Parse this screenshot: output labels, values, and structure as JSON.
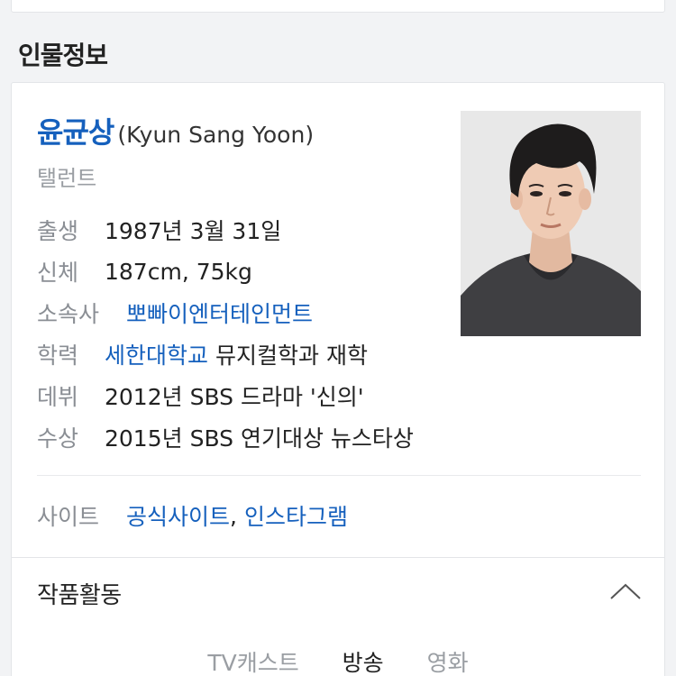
{
  "section": {
    "title": "인물정보"
  },
  "profile": {
    "name_ko": "윤균상",
    "name_en": "(Kyun Sang Yoon)",
    "occupation": "탤런트",
    "info": {
      "birth": {
        "label": "출생",
        "value": "1987년 3월 31일"
      },
      "body": {
        "label": "신체",
        "value": "187cm, 75kg"
      },
      "agency": {
        "label": "소속사",
        "value": "뽀빠이엔터테인먼트"
      },
      "education": {
        "label": "학력",
        "school": "세한대학교",
        "detail": "뮤지컬학과 재학"
      },
      "debut": {
        "label": "데뷔",
        "value": "2012년 SBS 드라마 '신의'"
      },
      "award": {
        "label": "수상",
        "value": "2015년 SBS 연기대상 뉴스타상"
      }
    },
    "site": {
      "label": "사이트",
      "links": [
        "공식사이트",
        "인스타그램"
      ],
      "separator": ","
    }
  },
  "works": {
    "title": "작품활동",
    "toggle_icon": "chevron-up-icon",
    "tabs": [
      {
        "label": "TV캐스트",
        "active": false
      },
      {
        "label": "방송",
        "active": true
      },
      {
        "label": "영화",
        "active": false
      }
    ]
  },
  "colors": {
    "link": "#1560bd",
    "label": "#8a8e94",
    "background": "#f2f3f5"
  }
}
